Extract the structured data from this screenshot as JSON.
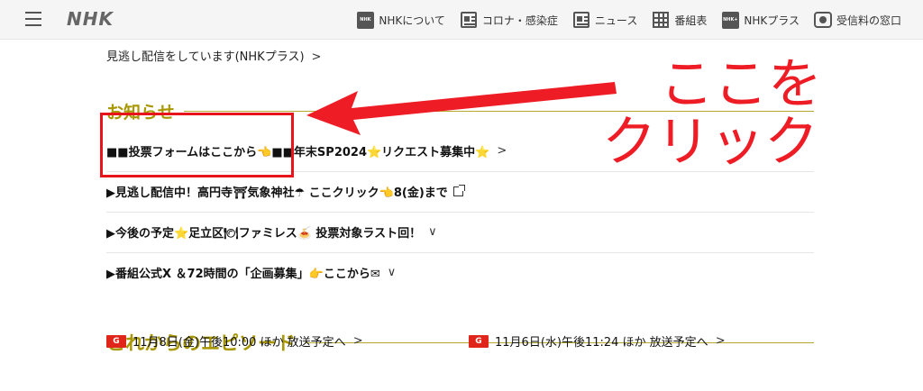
{
  "header": {
    "logo": "NHK",
    "nav": [
      {
        "label": "NHKについて",
        "icon": "nhk-square-icon",
        "icon_text": "NHK"
      },
      {
        "label": "コロナ・感染症",
        "icon": "news-article-icon"
      },
      {
        "label": "ニュース",
        "icon": "news-icon"
      },
      {
        "label": "番組表",
        "icon": "program-grid-icon"
      },
      {
        "label": "NHKプラス",
        "icon": "nhk-plus-icon",
        "icon_text": "NHK+"
      },
      {
        "label": "受信料の窓口",
        "icon": "tv-icon"
      }
    ]
  },
  "content": {
    "missed_link": "見逃し配信をしています(NHKプラス)",
    "notices_title": "お知らせ",
    "notices": [
      "■■投票フォームはここから👈■■年末SP2024⭐リクエスト募集中⭐",
      "▶見逃し配信中！高円寺⛩気象神社☂ ここクリック👈8(金)まで",
      "▶今後の予定⭐足立区🍽ファミレス🍝 投票対象ラスト回！",
      "▶番組公式X ＆72時間の「企画募集」👉ここから✉"
    ],
    "episodes_title": "これからのエピソード",
    "episodes": [
      {
        "badge": "G",
        "text": "11月8日(金)午後10:00 ほか 放送予定へ"
      },
      {
        "badge": "G",
        "text": "11月6日(水)午後11:24 ほか 放送予定へ"
      }
    ]
  },
  "annotation": {
    "line1": "ここを",
    "line2": "クリック",
    "color": "#ee1c24"
  }
}
